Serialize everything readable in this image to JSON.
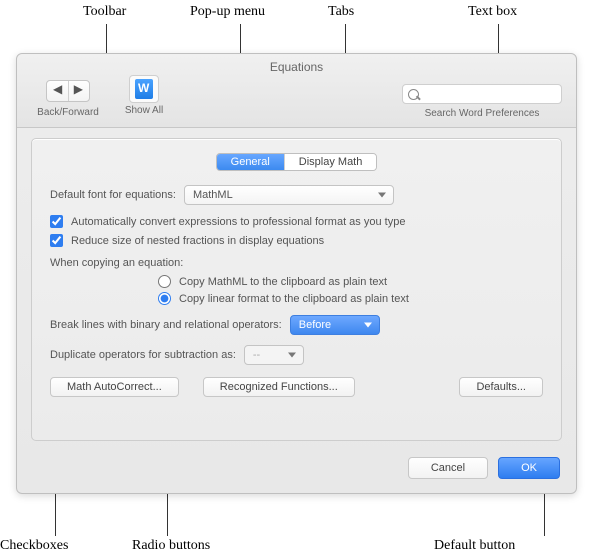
{
  "callouts": {
    "toolbar": "Toolbar",
    "popup": "Pop-up menu",
    "tabs": "Tabs",
    "textbox": "Text box",
    "checkboxes": "Checkboxes",
    "radios": "Radio buttons",
    "defaultbtn": "Default button"
  },
  "window": {
    "title": "Equations"
  },
  "toolbar": {
    "back_forward_label": "Back/Forward",
    "show_all_label": "Show All",
    "search_placeholder": "",
    "search_label": "Search Word Preferences"
  },
  "tabs": {
    "general": "General",
    "display_math": "Display Math"
  },
  "controls": {
    "default_font_label": "Default font for equations:",
    "default_font_value": "MathML",
    "auto_convert": "Automatically convert expressions to professional format as you type",
    "reduce_size": "Reduce size of nested fractions in display equations",
    "when_copying": "When copying an equation:",
    "copy_mathml": "Copy MathML to the clipboard as plain text",
    "copy_linear": "Copy linear format to the clipboard as plain text",
    "break_lines_label": "Break lines with binary and relational operators:",
    "break_lines_value": "Before",
    "dup_ops_label": "Duplicate operators for subtraction as:",
    "dup_ops_value": "--"
  },
  "buttons": {
    "math_autocorrect": "Math AutoCorrect...",
    "recognized_functions": "Recognized Functions...",
    "defaults": "Defaults...",
    "cancel": "Cancel",
    "ok": "OK"
  }
}
